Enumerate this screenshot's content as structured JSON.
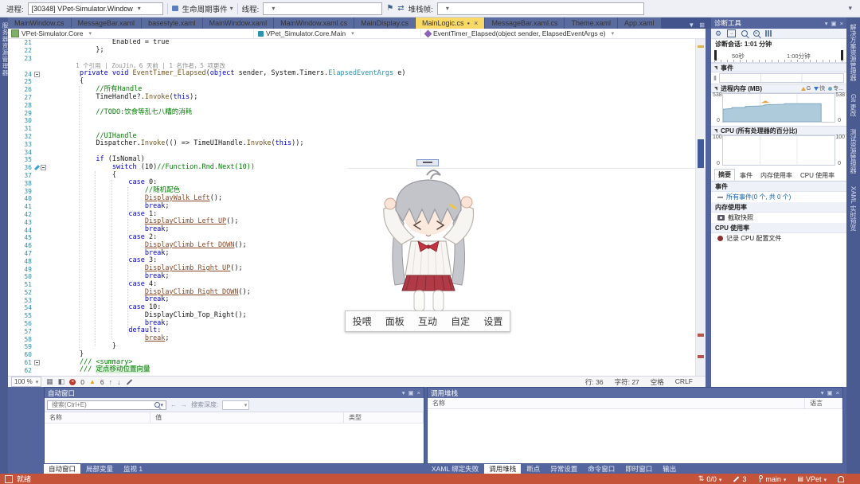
{
  "colors": {
    "active_tab": "#f8d968",
    "status_bar": "#c4533a",
    "memory_chart_fill": "#aecbdc",
    "keyword": "#0000d8",
    "type_name": "#2b91af",
    "comment": "#008000",
    "line_number": "#2b91af",
    "link": "#1464b0"
  },
  "debug_toolbar": {
    "process_label": "进程:",
    "process_value": "[30348] VPet-Simulator.Window",
    "lifecycle_label": "生命周期事件",
    "thread_label": "线程:",
    "stack_frame_label": "堆栈帧:"
  },
  "left_strip_tab": "服务器资源管理器",
  "tabs": [
    {
      "label": "MainWindow.cs"
    },
    {
      "label": "MessageBar.xaml"
    },
    {
      "label": "basestyle.xaml"
    },
    {
      "label": "MainWindow.xaml"
    },
    {
      "label": "MainWindow.xaml.cs"
    },
    {
      "label": "MainDisplay.cs"
    },
    {
      "label": "MainLogic.cs",
      "active": true,
      "modified": true
    },
    {
      "label": "MessageBar.xaml.cs"
    },
    {
      "label": "Theme.xaml"
    },
    {
      "label": "App.xaml"
    }
  ],
  "breadcrumb": {
    "project": "VPet-Simulator.Core",
    "type": "VPet_Simulator.Core.Main",
    "member": "EventTimer_Elapsed(object sender, ElapsedEventArgs e)"
  },
  "editor": {
    "lines": [
      {
        "n": "21",
        "segs": [
          [
            "p",
            "                Enabled = true"
          ]
        ]
      },
      {
        "n": "22",
        "segs": [
          [
            "p",
            "            };"
          ]
        ]
      },
      {
        "n": "23",
        "segs": []
      },
      {
        "n": "",
        "lens": 1,
        "segs": [
          [
            "lens",
            "        1 个引用 | ZouJin，6 天前 | 1 名作者，5 项更改"
          ]
        ]
      },
      {
        "n": "24",
        "fold": 1,
        "segs": [
          [
            "p",
            "        "
          ],
          [
            "k",
            "private"
          ],
          [
            "p",
            " "
          ],
          [
            "k",
            "void"
          ],
          [
            "p",
            " "
          ],
          [
            "m",
            "EventTimer_Elapsed"
          ],
          [
            "p",
            "("
          ],
          [
            "k",
            "object"
          ],
          [
            "p",
            " sender, System.Timers."
          ],
          [
            "t",
            "ElapsedEventArgs"
          ],
          [
            "p",
            " e)"
          ]
        ]
      },
      {
        "n": "25",
        "segs": [
          [
            "p",
            "        {"
          ]
        ]
      },
      {
        "n": "26",
        "segs": [
          [
            "p",
            "            "
          ],
          [
            "c",
            "//所有Handle"
          ]
        ]
      },
      {
        "n": "27",
        "segs": [
          [
            "p",
            "            TimeHandle?."
          ],
          [
            "m",
            "Invoke"
          ],
          [
            "p",
            "("
          ],
          [
            "k",
            "this"
          ],
          [
            "p",
            ");"
          ]
        ]
      },
      {
        "n": "28",
        "segs": []
      },
      {
        "n": "29",
        "segs": [
          [
            "p",
            "            "
          ],
          [
            "c",
            "//TODO:饮食等乱七八糟的消耗"
          ]
        ]
      },
      {
        "n": "30",
        "segs": []
      },
      {
        "n": "31",
        "segs": []
      },
      {
        "n": "32",
        "segs": [
          [
            "p",
            "            "
          ],
          [
            "c",
            "//UIHandle"
          ]
        ]
      },
      {
        "n": "33",
        "segs": [
          [
            "p",
            "            Dispatcher."
          ],
          [
            "m",
            "Invoke"
          ],
          [
            "p",
            "(() => TimeUIHandle."
          ],
          [
            "m",
            "Invoke"
          ],
          [
            "p",
            "("
          ],
          [
            "k",
            "this"
          ],
          [
            "p",
            "));"
          ]
        ]
      },
      {
        "n": "34",
        "segs": []
      },
      {
        "n": "35",
        "segs": [
          [
            "p",
            "            "
          ],
          [
            "k",
            "if"
          ],
          [
            "p",
            " (IsNomal)"
          ]
        ]
      },
      {
        "n": "36",
        "fold": 1,
        "mark": 1,
        "segs": [
          [
            "p",
            "                "
          ],
          [
            "k",
            "switch"
          ],
          [
            "p",
            " (10)"
          ],
          [
            "c",
            "//Function.Rnd.Next(10))"
          ]
        ]
      },
      {
        "n": "37",
        "segs": [
          [
            "p",
            "                {"
          ]
        ]
      },
      {
        "n": "38",
        "segs": [
          [
            "p",
            "                    "
          ],
          [
            "k",
            "case"
          ],
          [
            "p",
            " 0:"
          ]
        ]
      },
      {
        "n": "39",
        "segs": [
          [
            "p",
            "                        "
          ],
          [
            "c",
            "//随机配色"
          ]
        ]
      },
      {
        "n": "40",
        "segs": [
          [
            "p",
            "                        "
          ],
          [
            "u",
            "DisplayWalk_Left"
          ],
          [
            "p",
            "();"
          ]
        ]
      },
      {
        "n": "41",
        "segs": [
          [
            "p",
            "                        "
          ],
          [
            "k",
            "break"
          ],
          [
            "p",
            ";"
          ]
        ]
      },
      {
        "n": "42",
        "segs": [
          [
            "p",
            "                    "
          ],
          [
            "k",
            "case"
          ],
          [
            "p",
            " 1:"
          ]
        ]
      },
      {
        "n": "43",
        "segs": [
          [
            "p",
            "                        "
          ],
          [
            "u",
            "DisplayClimb_Left_UP"
          ],
          [
            "p",
            "();"
          ]
        ]
      },
      {
        "n": "44",
        "segs": [
          [
            "p",
            "                        "
          ],
          [
            "k",
            "break"
          ],
          [
            "p",
            ";"
          ]
        ]
      },
      {
        "n": "45",
        "segs": [
          [
            "p",
            "                    "
          ],
          [
            "k",
            "case"
          ],
          [
            "p",
            " 2:"
          ]
        ]
      },
      {
        "n": "46",
        "segs": [
          [
            "p",
            "                        "
          ],
          [
            "u",
            "DisplayClimb_Left_DOWN"
          ],
          [
            "p",
            "();"
          ]
        ]
      },
      {
        "n": "47",
        "segs": [
          [
            "p",
            "                        "
          ],
          [
            "k",
            "break"
          ],
          [
            "p",
            ";"
          ]
        ]
      },
      {
        "n": "48",
        "segs": [
          [
            "p",
            "                    "
          ],
          [
            "k",
            "case"
          ],
          [
            "p",
            " 3:"
          ]
        ]
      },
      {
        "n": "49",
        "segs": [
          [
            "p",
            "                        "
          ],
          [
            "u",
            "DisplayClimb_Right_UP"
          ],
          [
            "p",
            "();"
          ]
        ]
      },
      {
        "n": "50",
        "segs": [
          [
            "p",
            "                        "
          ],
          [
            "k",
            "break"
          ],
          [
            "p",
            ";"
          ]
        ]
      },
      {
        "n": "51",
        "segs": [
          [
            "p",
            "                    "
          ],
          [
            "k",
            "case"
          ],
          [
            "p",
            " 4:"
          ]
        ]
      },
      {
        "n": "52",
        "segs": [
          [
            "p",
            "                        "
          ],
          [
            "u",
            "DisplayClimb_Right_DOWN"
          ],
          [
            "p",
            "();"
          ]
        ]
      },
      {
        "n": "53",
        "segs": [
          [
            "p",
            "                        "
          ],
          [
            "k",
            "break"
          ],
          [
            "p",
            ";"
          ]
        ]
      },
      {
        "n": "54",
        "segs": [
          [
            "p",
            "                    "
          ],
          [
            "k",
            "case"
          ],
          [
            "p",
            " 10:"
          ]
        ]
      },
      {
        "n": "55",
        "segs": [
          [
            "p",
            "                        "
          ],
          [
            "p",
            "DisplayClimb_Top_Right"
          ],
          [
            "p",
            "();"
          ]
        ]
      },
      {
        "n": "56",
        "segs": [
          [
            "p",
            "                        "
          ],
          [
            "k",
            "break"
          ],
          [
            "p",
            ";"
          ]
        ]
      },
      {
        "n": "57",
        "segs": [
          [
            "p",
            "                    "
          ],
          [
            "k",
            "default"
          ],
          [
            "p",
            ":"
          ]
        ]
      },
      {
        "n": "58",
        "segs": [
          [
            "p",
            "                        "
          ],
          [
            "u",
            "break"
          ],
          [
            "p",
            ";"
          ]
        ]
      },
      {
        "n": "59",
        "segs": [
          [
            "p",
            "                }"
          ]
        ]
      },
      {
        "n": "60",
        "segs": [
          [
            "p",
            "        }"
          ]
        ]
      },
      {
        "n": "61",
        "fold": 1,
        "segs": [
          [
            "p",
            "        "
          ],
          [
            "c",
            "/// <summary>"
          ]
        ]
      },
      {
        "n": "62",
        "segs": [
          [
            "p",
            "        "
          ],
          [
            "c",
            "/// "
          ],
          [
            "ch",
            "定点移动位置向量"
          ]
        ]
      }
    ],
    "bottom": {
      "zoom": "100 %",
      "errors": "0",
      "warnings": "6",
      "line": "行: 36",
      "column": "字符: 27",
      "encoding": "空格",
      "line_ending": "CRLF"
    }
  },
  "pet": {
    "menu": [
      "投喂",
      "面板",
      "互动",
      "自定",
      "设置"
    ]
  },
  "diagnostics": {
    "title": "诊断工具",
    "session": "诊断会话: 1:01 分钟",
    "ruler": {
      "tick1": "50秒",
      "tick2": "1:00分钟"
    },
    "events_header": "事件",
    "memory_header": "进程内存 (MB)",
    "memory_legend": [
      {
        "label": "G"
      },
      {
        "label": "快"
      },
      {
        "label": "专..."
      }
    ],
    "memory_axis": {
      "max": "538",
      "min": "0"
    },
    "cpu_header": "CPU (所有处理器的百分比)",
    "cpu_axis": {
      "max": "100",
      "min": "0"
    },
    "tabs": [
      {
        "label": "摘要",
        "active": true
      },
      {
        "label": "事件"
      },
      {
        "label": "内存使用率"
      },
      {
        "label": "CPU 使用率"
      }
    ],
    "summary": {
      "events_header": "事件",
      "all_events": "所有事件(0 个, 共 0 个)",
      "memory_header": "内存使用率",
      "snapshot": "截取快照",
      "cpu_header": "CPU 使用率",
      "record": "记录 CPU 配置文件"
    }
  },
  "right_strip": [
    "解决方案资源管理器",
    "Git 更改",
    "测试资源管理器",
    "XAML 实时预览"
  ],
  "autos": {
    "title": "自动窗口",
    "search_placeholder": "搜索(Ctrl+E)",
    "depth_label": "搜索深度:",
    "columns": [
      "名称",
      "值",
      "类型"
    ]
  },
  "call_stack": {
    "title": "调用堆栈",
    "columns": [
      "名称",
      "语言"
    ]
  },
  "bottom_left_tabs": [
    {
      "label": "自动窗口",
      "active": true
    },
    {
      "label": "局部变量"
    },
    {
      "label": "监视 1"
    }
  ],
  "bottom_right_tabs": [
    {
      "label": "XAML 绑定失败"
    },
    {
      "label": "调用堆栈",
      "active": true
    },
    {
      "label": "断点"
    },
    {
      "label": "异常设置"
    },
    {
      "label": "命令窗口"
    },
    {
      "label": "即时窗口"
    },
    {
      "label": "输出"
    }
  ],
  "status_bar": {
    "ready": "就绪",
    "sync": "0/0",
    "edits": "3",
    "branch": "main",
    "repo": "VPet"
  }
}
